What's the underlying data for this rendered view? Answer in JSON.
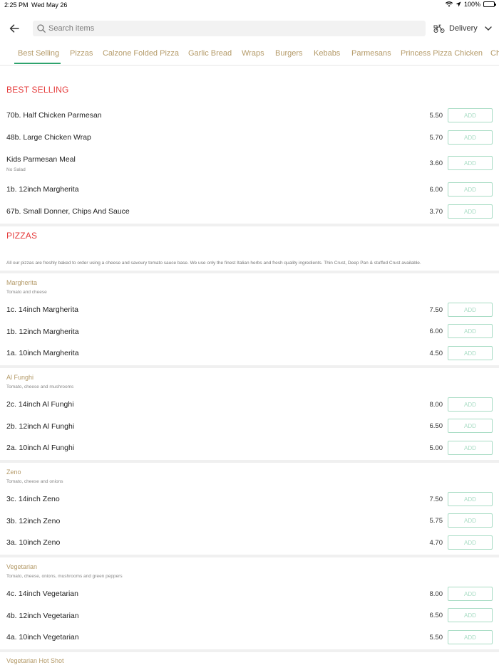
{
  "status": {
    "time": "2:25 PM",
    "date": "Wed May 26",
    "battery": "100%"
  },
  "search": {
    "placeholder": "Search items"
  },
  "delivery": {
    "label": "Delivery"
  },
  "tabs": [
    "Best Selling",
    "Pizzas",
    "Calzone Folded Pizza",
    "Garlic Bread",
    "Wraps",
    "Burgers",
    "Kebabs",
    "Parmesans",
    "Princess Pizza Chicken",
    "Ch"
  ],
  "add_label": "ADD",
  "best_selling": {
    "title": "BEST SELLING",
    "items": [
      {
        "name": "70b. Half Chicken Parmesan",
        "price": "5.50"
      },
      {
        "name": "48b. Large Chicken Wrap",
        "price": "5.70"
      },
      {
        "name": "Kids Parmesan Meal",
        "sub": "No Salad",
        "price": "3.60"
      },
      {
        "name": "1b. 12inch Margherita",
        "price": "6.00"
      },
      {
        "name": "67b. Small Donner, Chips And Sauce",
        "price": "3.70"
      }
    ]
  },
  "pizzas": {
    "title": "PIZZAS",
    "description": "All our pizzas are freshly baked to order using a cheese and savoury tomato sauce base. We use only the finest Italian herbs and fresh quality ingredients. Thin Crust, Deep Pan & stuffed Crust available.",
    "groups": [
      {
        "title": "Margherita",
        "desc": "Tomato and cheese",
        "items": [
          {
            "name": "1c. 14inch Margherita",
            "price": "7.50"
          },
          {
            "name": "1b. 12inch Margherita",
            "price": "6.00"
          },
          {
            "name": "1a. 10inch Margherita",
            "price": "4.50"
          }
        ]
      },
      {
        "title": "Al Funghi",
        "desc": "Tomato, cheese and mushrooms",
        "items": [
          {
            "name": "2c. 14inch Al Funghi",
            "price": "8.00"
          },
          {
            "name": "2b. 12inch Al Funghi",
            "price": "6.50"
          },
          {
            "name": "2a. 10inch Al Funghi",
            "price": "5.00"
          }
        ]
      },
      {
        "title": "Zeno",
        "desc": "Tomato, cheese and onions",
        "items": [
          {
            "name": "3c. 14inch Zeno",
            "price": "7.50"
          },
          {
            "name": "3b. 12inch Zeno",
            "price": "5.75"
          },
          {
            "name": "3a. 10inch Zeno",
            "price": "4.70"
          }
        ]
      },
      {
        "title": "Vegetarian",
        "desc": "Tomato, cheese, onions, mushrooms and green peppers",
        "items": [
          {
            "name": "4c. 14inch Vegetarian",
            "price": "8.00"
          },
          {
            "name": "4b. 12inch Vegetarian",
            "price": "6.50"
          },
          {
            "name": "4a. 10inch Vegetarian",
            "price": "5.50"
          }
        ]
      },
      {
        "title": "Vegetarian Hot Shot"
      }
    ]
  },
  "colors": {
    "accent_green": "#2ea36d",
    "section_red": "#e53b3b",
    "tab_gold": "#b49a68",
    "add_border": "#a8dcc4"
  }
}
